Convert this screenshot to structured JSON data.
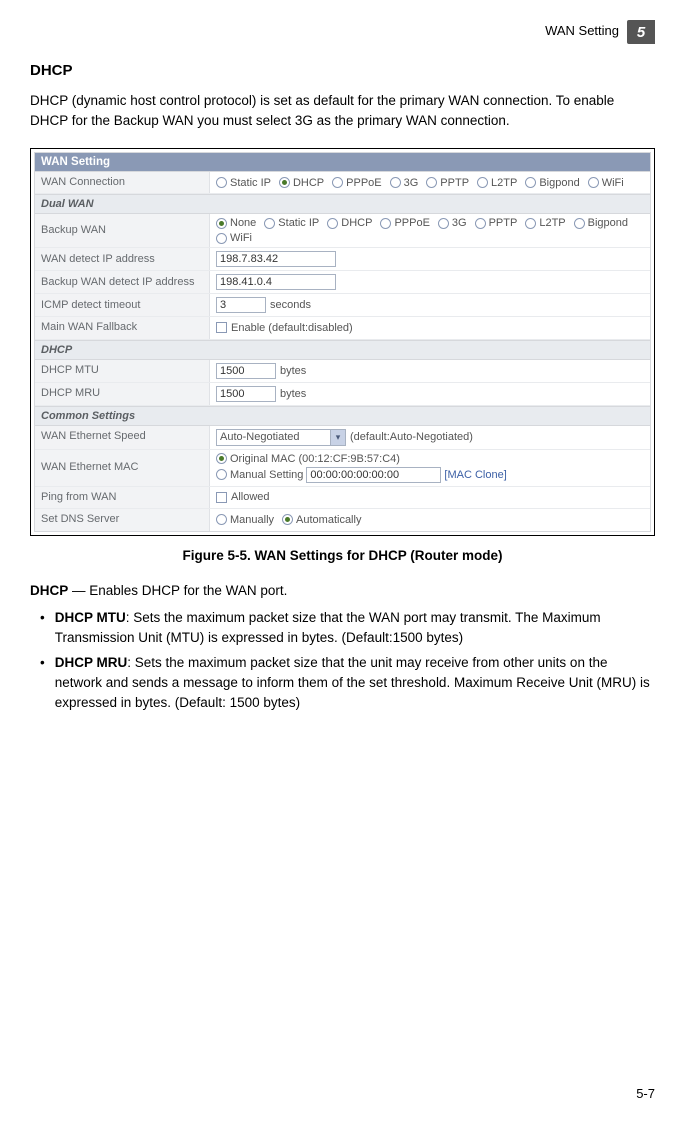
{
  "header": {
    "breadcrumb": "WAN Setting",
    "chapter_num": "5"
  },
  "section_title": "DHCP",
  "intro": "DHCP (dynamic host control protocol) is set as default for the primary WAN connection. To enable DHCP for the Backup WAN you must select 3G as the primary WAN connection.",
  "panel": {
    "title": "WAN Setting",
    "wan_connection": {
      "label": "WAN Connection",
      "options": [
        "Static IP",
        "DHCP",
        "PPPoE",
        "3G",
        "PPTP",
        "L2TP",
        "Bigpond",
        "WiFi"
      ],
      "selected": "DHCP"
    },
    "dualwan_header": "Dual WAN",
    "backup_wan": {
      "label": "Backup WAN",
      "options": [
        "None",
        "Static IP",
        "DHCP",
        "PPPoE",
        "3G",
        "PPTP",
        "L2TP",
        "Bigpond",
        "WiFi"
      ],
      "selected": "None"
    },
    "wan_detect_ip": {
      "label": "WAN detect IP address",
      "value": "198.7.83.42"
    },
    "backup_detect_ip": {
      "label": "Backup WAN detect IP address",
      "value": "198.41.0.4"
    },
    "icmp_timeout": {
      "label": "ICMP detect timeout",
      "value": "3",
      "unit": "seconds"
    },
    "main_wan_fallback": {
      "label": "Main WAN Fallback",
      "text": "Enable (default:disabled)",
      "checked": false
    },
    "dhcp_header": "DHCP",
    "dhcp_mtu": {
      "label": "DHCP MTU",
      "value": "1500",
      "unit": "bytes"
    },
    "dhcp_mru": {
      "label": "DHCP MRU",
      "value": "1500",
      "unit": "bytes"
    },
    "common_header": "Common Settings",
    "wan_eth_speed": {
      "label": "WAN Ethernet Speed",
      "value": "Auto-Negotiated",
      "default_text": "(default:Auto-Negotiated)"
    },
    "wan_eth_mac": {
      "label": "WAN Ethernet MAC",
      "original_label": "Original MAC (00:12:CF:9B:57:C4)",
      "manual_label": "Manual Setting",
      "manual_value": "00:00:00:00:00:00",
      "clone_link": "[MAC Clone]",
      "selected": "original"
    },
    "ping_from_wan": {
      "label": "Ping from WAN",
      "text": "Allowed",
      "checked": false
    },
    "set_dns": {
      "label": "Set DNS Server",
      "options": [
        "Manually",
        "Automatically"
      ],
      "selected": "Automatically"
    }
  },
  "figure_caption": "Figure 5-5.   WAN Settings for DHCP (Router mode)",
  "desc": {
    "lead_bold": "DHCP",
    "lead_rest": " — Enables  DHCP for the WAN port.",
    "mtu_bold": "DHCP MTU",
    "mtu_rest": ": Sets the maximum packet size that the WAN port may transmit. The Maximum Transmission Unit (MTU) is expressed in bytes. (Default:1500 bytes)",
    "mru_bold": "DHCP MRU",
    "mru_rest": ": Sets the maximum packet size that the unit may receive from other units on the network and sends a message to inform them of the set threshold. Maximum Receive Unit (MRU) is expressed in bytes. (Default: 1500 bytes)"
  },
  "page_number": "5-7"
}
